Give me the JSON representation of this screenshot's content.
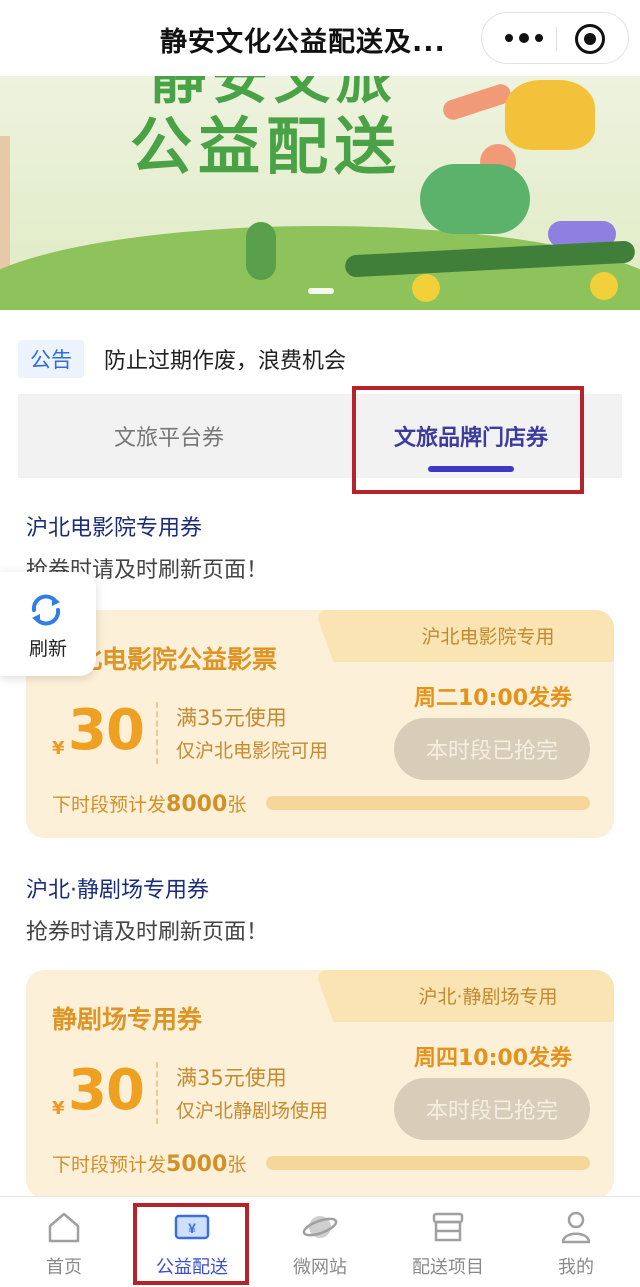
{
  "header": {
    "title": "静安文化公益配送及..."
  },
  "banner": {
    "text_line1": "静安文旅",
    "text_line2": "公益配送"
  },
  "notice": {
    "tag": "公告",
    "text": "防止过期作废，浪费机会"
  },
  "tabs": [
    {
      "label": "文旅平台券",
      "active": false
    },
    {
      "label": "文旅品牌门店券",
      "active": true
    }
  ],
  "float_button": {
    "label": "刷新",
    "icon": "refresh-icon"
  },
  "sections": [
    {
      "title": "沪北电影院专用券",
      "subtitle": "抢券时请及时刷新页面！",
      "coupon": {
        "name": "沪北电影院公益影票",
        "tag": "沪北电影院专用",
        "currency": "¥",
        "amount": "30",
        "condition": "满35元使用",
        "scope": "仅沪北电影院可用",
        "release_time": "周二10:00发券",
        "button": "本时段已抢完",
        "next_prefix": "下时段预计发",
        "next_count": "8000",
        "next_suffix": "张"
      }
    },
    {
      "title": "沪北·静剧场专用券",
      "subtitle": "抢券时请及时刷新页面！",
      "coupon": {
        "name": "静剧场专用券",
        "tag": "沪北·静剧场专用",
        "currency": "¥",
        "amount": "30",
        "condition": "满35元使用",
        "scope": "仅沪北静剧场使用",
        "release_time": "周四10:00发券",
        "button": "本时段已抢完",
        "next_prefix": "下时段预计发",
        "next_count": "5000",
        "next_suffix": "张"
      }
    }
  ],
  "bottom_nav": [
    {
      "label": "首页",
      "icon": "home-icon",
      "active": false
    },
    {
      "label": "公益配送",
      "icon": "ticket-yen-icon",
      "active": true
    },
    {
      "label": "微网站",
      "icon": "planet-icon",
      "active": false
    },
    {
      "label": "配送项目",
      "icon": "store-icon",
      "active": false
    },
    {
      "label": "我的",
      "icon": "user-icon",
      "active": false
    }
  ],
  "colors": {
    "accent_blue": "#3b4fd1",
    "coupon_orange": "#f0a020",
    "annotation_red": "#b5242a"
  }
}
